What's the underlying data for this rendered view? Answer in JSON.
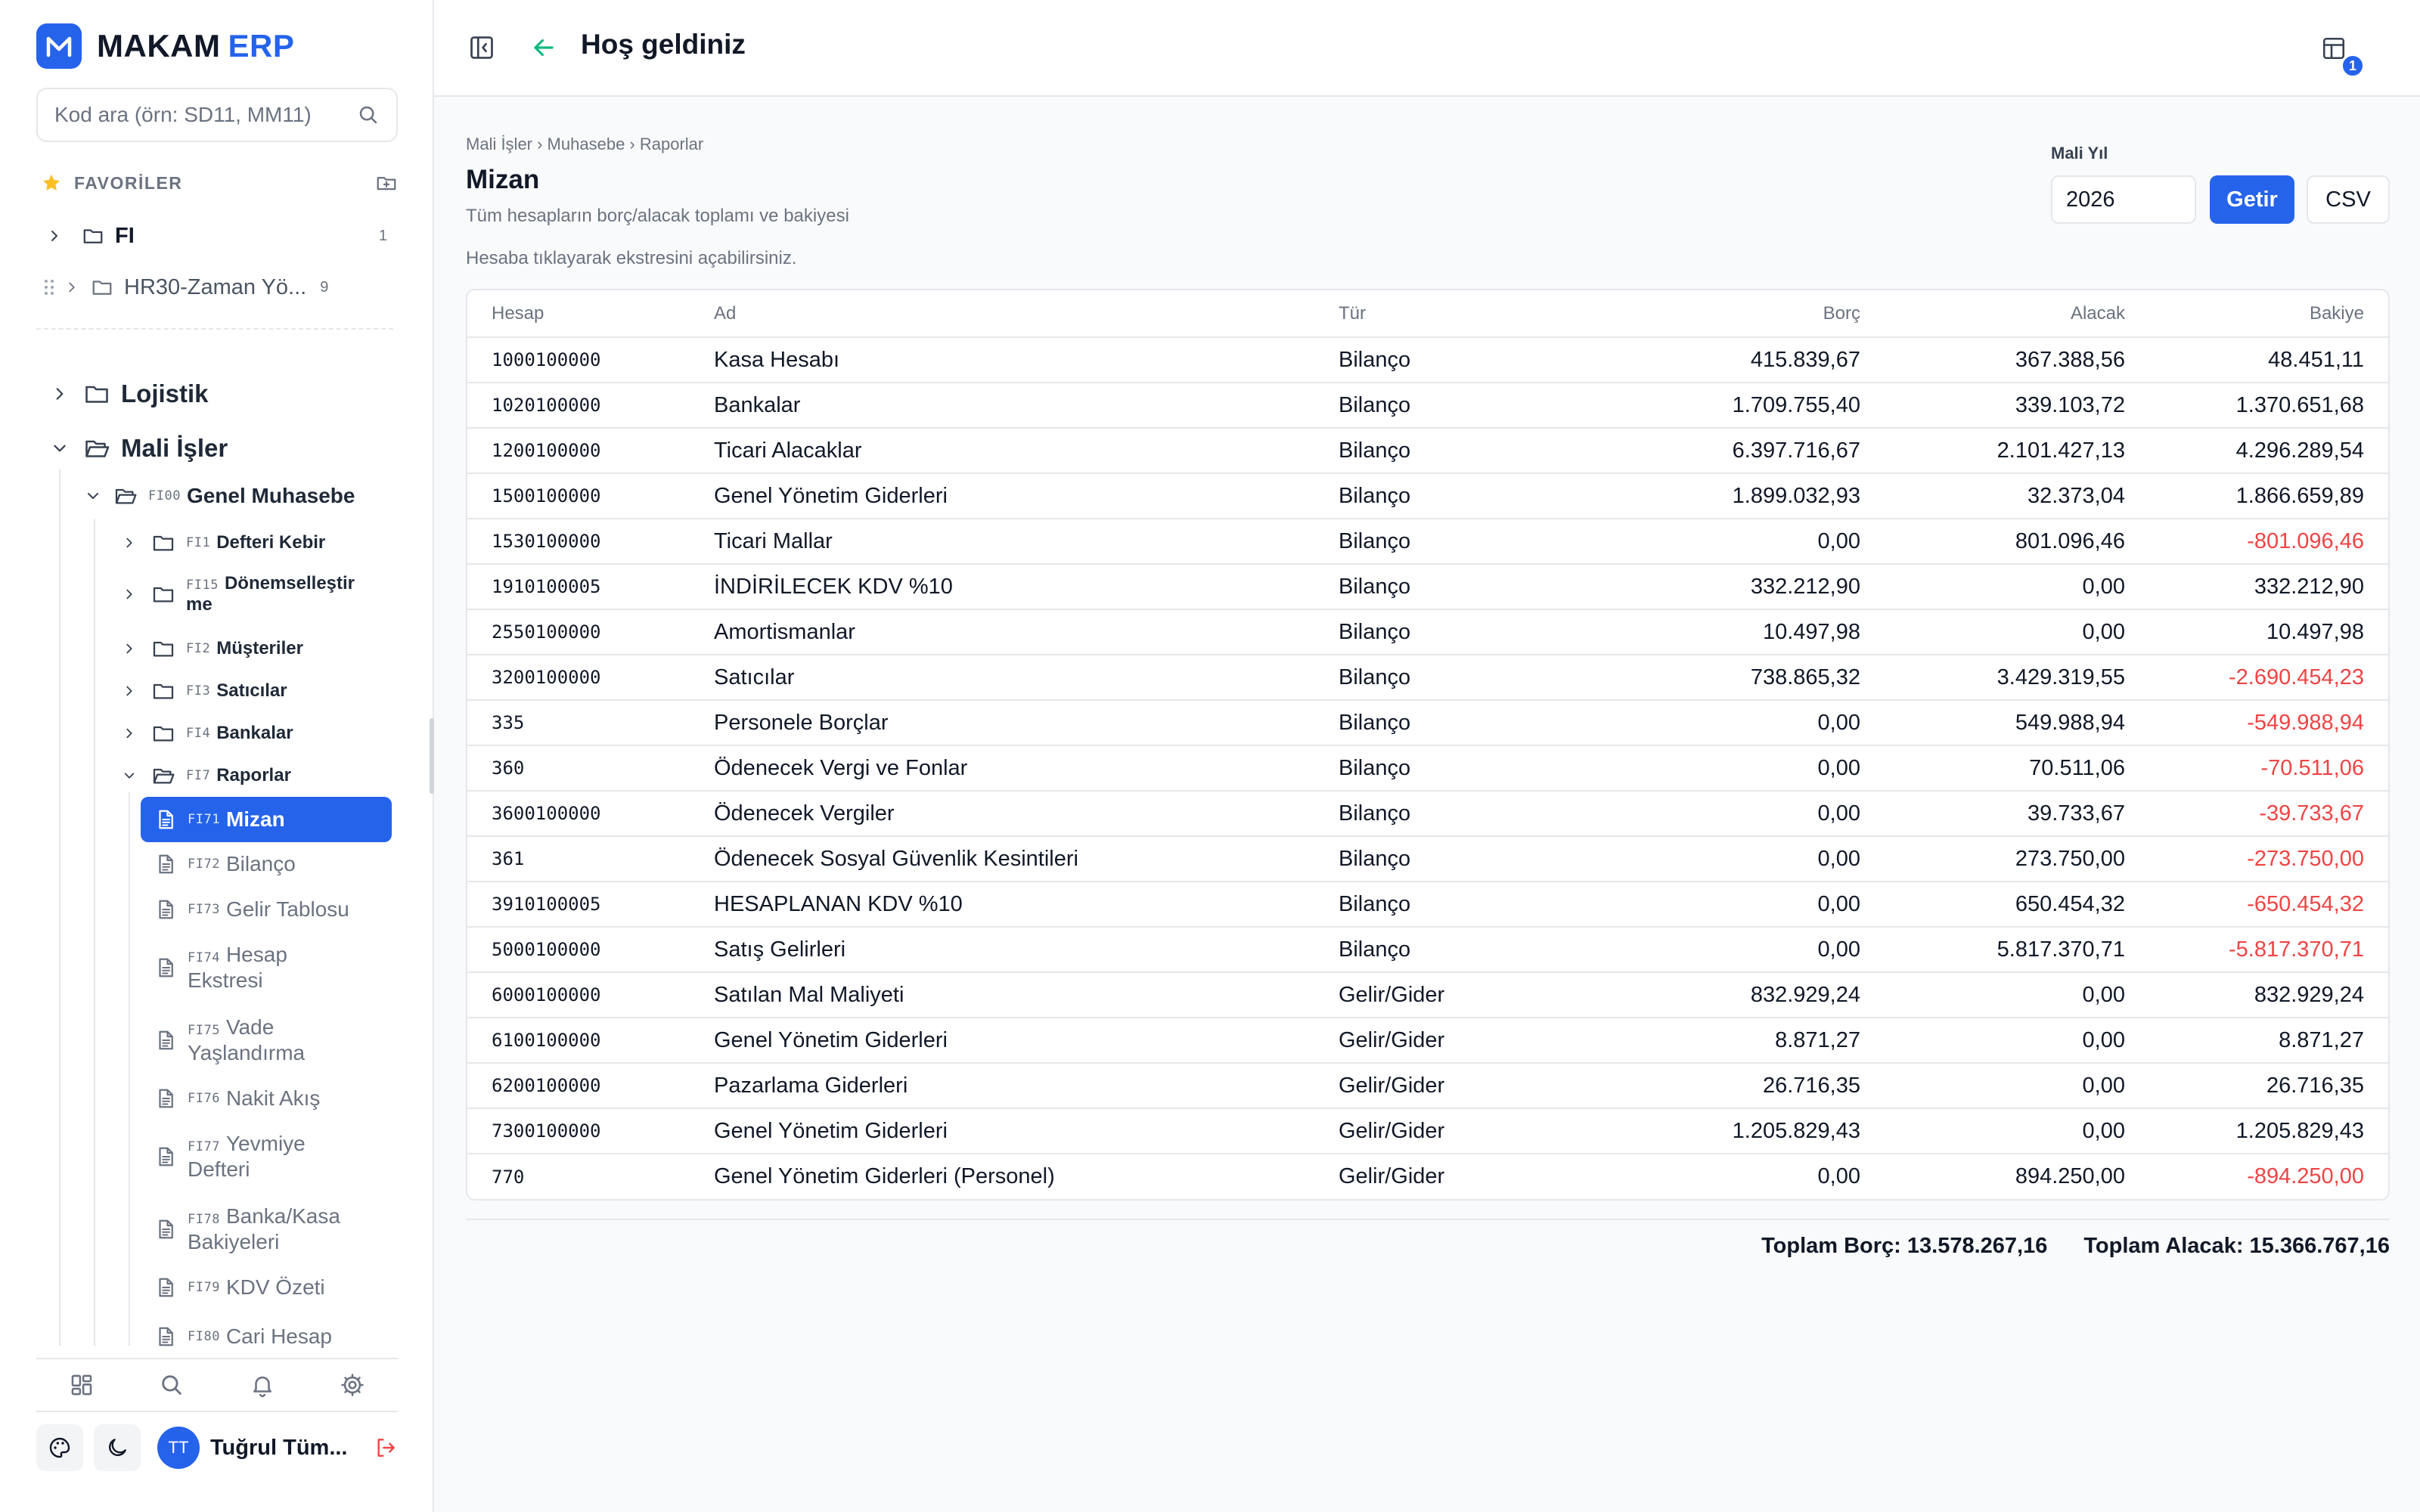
{
  "app": {
    "brand_main": "MAKAM",
    "brand_accent": "ERP",
    "accent_color": "#2563eb"
  },
  "sidebar": {
    "search_placeholder": "Kod ara (örn: SD11, MM11)",
    "favorites_label": "FAVORİLER",
    "favorites": [
      {
        "label": "FI",
        "count": "1"
      },
      {
        "label": "HR30-Zaman Yö...",
        "count": "9"
      }
    ],
    "tree": {
      "lojistik": "Lojistik",
      "mali_isler": "Mali İşler",
      "genel_muhasebe": {
        "code": "FI00",
        "label": "Genel Muhasebe"
      },
      "folders": [
        {
          "code": "FI1",
          "label": "Defteri Kebir"
        },
        {
          "code": "FI15",
          "label": "Dönemselleştir",
          "label2": "me"
        },
        {
          "code": "FI2",
          "label": "Müşteriler"
        },
        {
          "code": "FI3",
          "label": "Satıcılar"
        },
        {
          "code": "FI4",
          "label": "Bankalar"
        },
        {
          "code": "FI7",
          "label": "Raporlar"
        }
      ],
      "leaves": [
        {
          "code": "FI71",
          "label": "Mizan"
        },
        {
          "code": "FI72",
          "label": "Bilanço"
        },
        {
          "code": "FI73",
          "label": "Gelir Tablosu"
        },
        {
          "code": "FI74",
          "label": "Hesap",
          "label2": "Ekstresi"
        },
        {
          "code": "FI75",
          "label": "Vade",
          "label2": "Yaşlandırma"
        },
        {
          "code": "FI76",
          "label": "Nakit Akış"
        },
        {
          "code": "FI77",
          "label": "Yevmiye",
          "label2": "Defteri"
        },
        {
          "code": "FI78",
          "label": "Banka/Kasa",
          "label2": "Bakiyeleri"
        },
        {
          "code": "FI79",
          "label": "KDV Özeti"
        },
        {
          "code": "FI80",
          "label": "Cari Hesap"
        }
      ]
    },
    "user": {
      "initials": "TT",
      "name": "Tuğrul Tüm..."
    }
  },
  "header": {
    "title": "Hoş geldiniz",
    "notification_count": "1"
  },
  "page": {
    "breadcrumb": "Mali İşler › Muhasebe › Raporlar",
    "title": "Mizan",
    "subtitle": "Tüm hesapların borç/alacak toplamı ve bakiyesi",
    "hint": "Hesaba tıklayarak ekstresini açabilirsiniz.",
    "year_label": "Mali Yıl",
    "year_value": "2026",
    "fetch_label": "Getir",
    "csv_label": "CSV"
  },
  "table": {
    "columns": [
      "Hesap",
      "Ad",
      "Tür",
      "Borç",
      "Alacak",
      "Bakiye"
    ],
    "rows": [
      {
        "hesap": "1000100000",
        "ad": "Kasa Hesabı",
        "tur": "Bilanço",
        "borc": "415.839,67",
        "alacak": "367.388,56",
        "bakiye": "48.451,11"
      },
      {
        "hesap": "1020100000",
        "ad": "Bankalar",
        "tur": "Bilanço",
        "borc": "1.709.755,40",
        "alacak": "339.103,72",
        "bakiye": "1.370.651,68"
      },
      {
        "hesap": "1200100000",
        "ad": "Ticari Alacaklar",
        "tur": "Bilanço",
        "borc": "6.397.716,67",
        "alacak": "2.101.427,13",
        "bakiye": "4.296.289,54"
      },
      {
        "hesap": "1500100000",
        "ad": "Genel Yönetim Giderleri",
        "tur": "Bilanço",
        "borc": "1.899.032,93",
        "alacak": "32.373,04",
        "bakiye": "1.866.659,89"
      },
      {
        "hesap": "1530100000",
        "ad": "Ticari Mallar",
        "tur": "Bilanço",
        "borc": "0,00",
        "alacak": "801.096,46",
        "bakiye": "-801.096,46"
      },
      {
        "hesap": "1910100005",
        "ad": "İNDİRİLECEK KDV %10",
        "tur": "Bilanço",
        "borc": "332.212,90",
        "alacak": "0,00",
        "bakiye": "332.212,90"
      },
      {
        "hesap": "2550100000",
        "ad": "Amortismanlar",
        "tur": "Bilanço",
        "borc": "10.497,98",
        "alacak": "0,00",
        "bakiye": "10.497,98"
      },
      {
        "hesap": "3200100000",
        "ad": "Satıcılar",
        "tur": "Bilanço",
        "borc": "738.865,32",
        "alacak": "3.429.319,55",
        "bakiye": "-2.690.454,23"
      },
      {
        "hesap": "335",
        "ad": "Personele Borçlar",
        "tur": "Bilanço",
        "borc": "0,00",
        "alacak": "549.988,94",
        "bakiye": "-549.988,94"
      },
      {
        "hesap": "360",
        "ad": "Ödenecek Vergi ve Fonlar",
        "tur": "Bilanço",
        "borc": "0,00",
        "alacak": "70.511,06",
        "bakiye": "-70.511,06"
      },
      {
        "hesap": "3600100000",
        "ad": "Ödenecek Vergiler",
        "tur": "Bilanço",
        "borc": "0,00",
        "alacak": "39.733,67",
        "bakiye": "-39.733,67"
      },
      {
        "hesap": "361",
        "ad": "Ödenecek Sosyal Güvenlik Kesintileri",
        "tur": "Bilanço",
        "borc": "0,00",
        "alacak": "273.750,00",
        "bakiye": "-273.750,00"
      },
      {
        "hesap": "3910100005",
        "ad": "HESAPLANAN KDV %10",
        "tur": "Bilanço",
        "borc": "0,00",
        "alacak": "650.454,32",
        "bakiye": "-650.454,32"
      },
      {
        "hesap": "5000100000",
        "ad": "Satış Gelirleri",
        "tur": "Bilanço",
        "borc": "0,00",
        "alacak": "5.817.370,71",
        "bakiye": "-5.817.370,71"
      },
      {
        "hesap": "6000100000",
        "ad": "Satılan Mal Maliyeti",
        "tur": "Gelir/Gider",
        "borc": "832.929,24",
        "alacak": "0,00",
        "bakiye": "832.929,24"
      },
      {
        "hesap": "6100100000",
        "ad": "Genel Yönetim Giderleri",
        "tur": "Gelir/Gider",
        "borc": "8.871,27",
        "alacak": "0,00",
        "bakiye": "8.871,27"
      },
      {
        "hesap": "6200100000",
        "ad": "Pazarlama Giderleri",
        "tur": "Gelir/Gider",
        "borc": "26.716,35",
        "alacak": "0,00",
        "bakiye": "26.716,35"
      },
      {
        "hesap": "7300100000",
        "ad": "Genel Yönetim Giderleri",
        "tur": "Gelir/Gider",
        "borc": "1.205.829,43",
        "alacak": "0,00",
        "bakiye": "1.205.829,43"
      },
      {
        "hesap": "770",
        "ad": "Genel Yönetim Giderleri (Personel)",
        "tur": "Gelir/Gider",
        "borc": "0,00",
        "alacak": "894.250,00",
        "bakiye": "-894.250,00"
      }
    ]
  },
  "totals": {
    "borc": "Toplam Borç: 13.578.267,16",
    "alacak": "Toplam Alacak: 15.366.767,16"
  },
  "colors": {
    "negative": "#ef4444",
    "muted": "#6b7280",
    "border": "#e5e7eb"
  },
  "icons": [
    "search-icon",
    "star-icon",
    "folder-icon",
    "folder-open-icon",
    "chevron-right-icon",
    "chevron-down-icon",
    "document-icon",
    "grid-icon",
    "bell-icon",
    "gear-icon",
    "palette-icon",
    "moon-icon",
    "logout-icon",
    "sidebar-toggle-icon",
    "arrow-left-icon",
    "layout-icon"
  ]
}
